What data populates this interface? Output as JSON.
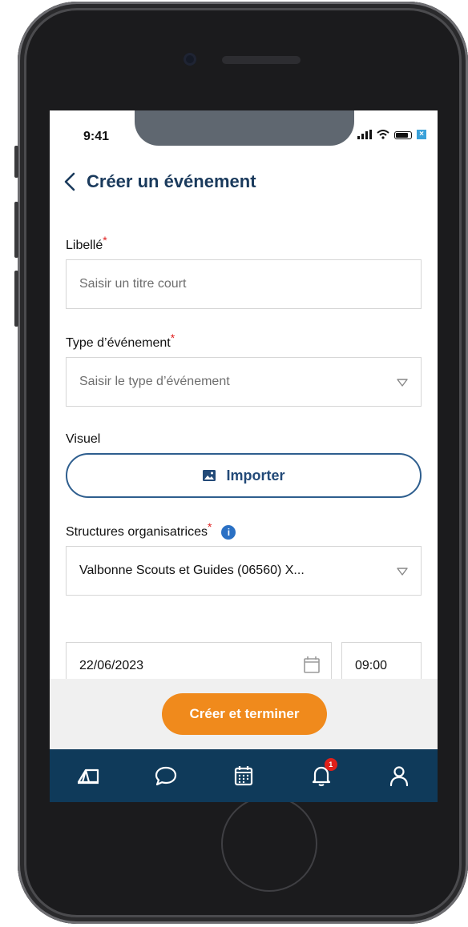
{
  "status_bar": {
    "time": "9:41"
  },
  "header": {
    "title": "Créer un événement"
  },
  "form": {
    "libelle": {
      "label": "Libellé",
      "required_mark": "*",
      "placeholder": "Saisir un titre court"
    },
    "type": {
      "label": "Type d’événement",
      "required_mark": "*",
      "placeholder": "Saisir le type d’événement"
    },
    "visuel": {
      "label": "Visuel",
      "button_label": "Importer"
    },
    "structures": {
      "label": "Structures organisatrices",
      "required_mark": "*",
      "info": "i",
      "value": "Valbonne Scouts et Guides (06560) X..."
    },
    "date": {
      "value": "22/06/2023"
    },
    "time": {
      "value": "09:00"
    }
  },
  "actions": {
    "create_label": "Créer et terminer"
  },
  "bottom_nav": {
    "notification_count": "1",
    "items": [
      "camp-icon",
      "chat-icon",
      "calendar-icon",
      "bell-icon",
      "user-icon"
    ]
  },
  "colors": {
    "primary_dark": "#0f3a5a",
    "title": "#1a3a5c",
    "accent": "#f08a1c",
    "required": "#e02020",
    "outline": "#2e5e8e"
  }
}
